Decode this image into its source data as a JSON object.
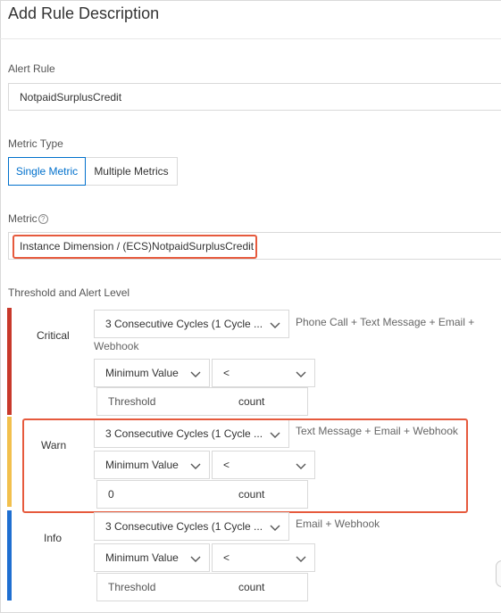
{
  "header": {
    "title": "Add Rule Description"
  },
  "alert_rule": {
    "label": "Alert Rule",
    "value": "NotpaidSurplusCredit"
  },
  "metric_type": {
    "label": "Metric Type",
    "options": [
      "Single Metric",
      "Multiple Metrics"
    ],
    "selected": "Single Metric"
  },
  "metric": {
    "label": "Metric",
    "help_icon": "question-circle-icon",
    "value": "Instance Dimension / (ECS)NotpaidSurplusCredit"
  },
  "threshold_section": {
    "label": "Threshold and Alert Level"
  },
  "levels": [
    {
      "name": "Critical",
      "color": "#c8392b",
      "cycles": "3 Consecutive Cycles (1 Cycle ...",
      "notify": "Phone Call + Text Message + Email + Webhook",
      "stat": "Minimum Value",
      "operator": "<",
      "threshold_value": "",
      "threshold_placeholder": "Threshold",
      "unit": "count"
    },
    {
      "name": "Warn",
      "color": "#f2c04d",
      "cycles": "3 Consecutive Cycles (1 Cycle ...",
      "notify": "Text Message + Email + Webhook",
      "stat": "Minimum Value",
      "operator": "<",
      "threshold_value": "0",
      "threshold_placeholder": "Threshold",
      "unit": "count"
    },
    {
      "name": "Info",
      "color": "#1f6fd1",
      "cycles": "3 Consecutive Cycles (1 Cycle ...",
      "notify": "Email + Webhook",
      "stat": "Minimum Value",
      "operator": "<",
      "threshold_value": "",
      "threshold_placeholder": "Threshold",
      "unit": "count"
    }
  ],
  "colors": {
    "accent": "#0070cc",
    "highlight_box": "#e65a3d",
    "border": "#d9d9d9"
  }
}
